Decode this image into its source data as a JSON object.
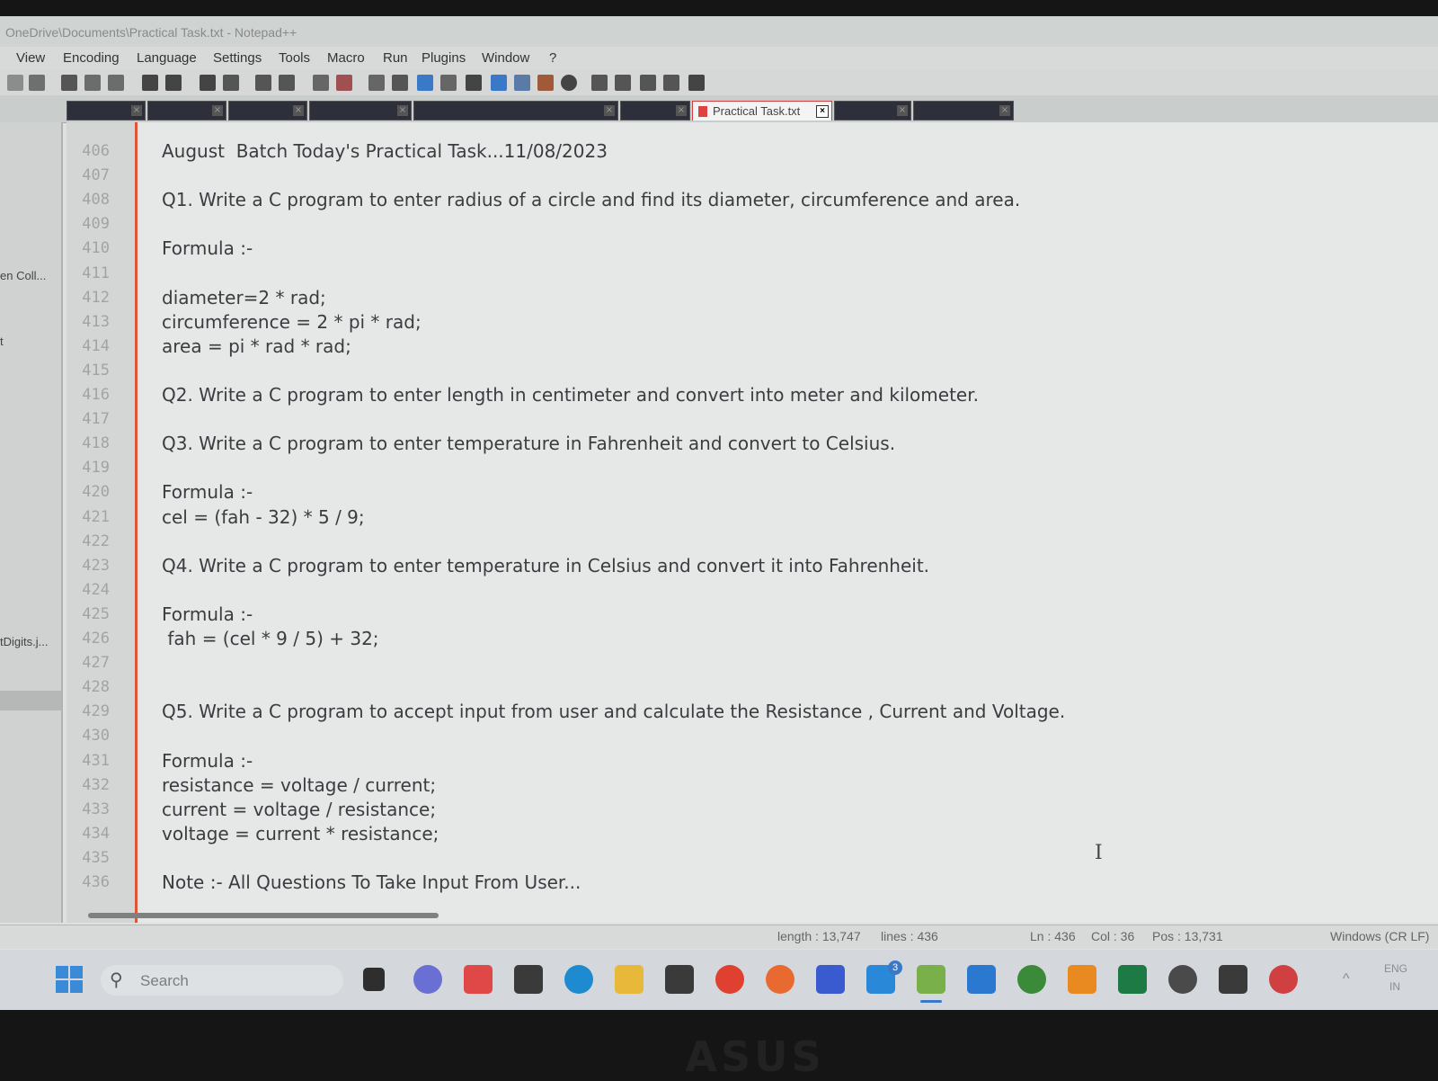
{
  "window": {
    "title": "OneDrive\\Documents\\Practical Task.txt - Notepad++"
  },
  "menu": [
    "View",
    "Encoding",
    "Language",
    "Settings",
    "Tools",
    "Macro",
    "Run",
    "Plugins",
    "Window",
    "?"
  ],
  "active_tab": {
    "label": "Practical Task.txt",
    "close": "×"
  },
  "left_panel": {
    "item1": "en Coll...",
    "item2": "t",
    "item3": "tDigits.j..."
  },
  "editor": {
    "line_numbers": [
      "406",
      "407",
      "408",
      "409",
      "410",
      "411",
      "412",
      "413",
      "414",
      "415",
      "416",
      "417",
      "418",
      "419",
      "420",
      "421",
      "422",
      "423",
      "424",
      "425",
      "426",
      "427",
      "428",
      "429",
      "430",
      "431",
      "432",
      "433",
      "434",
      "435",
      "436"
    ],
    "lines": [
      "August  Batch Today's Practical Task...11/08/2023",
      "",
      "Q1. Write a C program to enter radius of a circle and find its diameter, circumference and area.",
      "",
      "Formula :-",
      "",
      "diameter=2 * rad;",
      "circumference = 2 * pi * rad;",
      "area = pi * rad * rad;",
      "",
      "Q2. Write a C program to enter length in centimeter and convert into meter and kilometer.",
      "",
      "Q3. Write a C program to enter temperature in Fahrenheit and convert to Celsius.",
      "",
      "Formula :-",
      "cel = (fah - 32) * 5 / 9;",
      "",
      "Q4. Write a C program to enter temperature in Celsius and convert it into Fahrenheit.",
      "",
      "Formula :-",
      " fah = (cel * 9 / 5) + 32;",
      "",
      "",
      "Q5. Write a C program to accept input from user and calculate the Resistance , Current and Voltage.",
      "",
      "Formula :-",
      "resistance = voltage / current;",
      "current = voltage / resistance;",
      "voltage = current * resistance;",
      "",
      "Note :- All Questions To Take Input From User..."
    ]
  },
  "status": {
    "length": "length : 13,747",
    "lines": "lines : 436",
    "ln": "Ln : 436",
    "col": "Col : 36",
    "pos": "Pos : 13,731",
    "eol": "Windows (CR LF)"
  },
  "taskbar": {
    "search_placeholder": "Search",
    "mail_badge": "3",
    "tray_lang": "ENG",
    "tray_region": "IN"
  },
  "bezel_logo": "ASUS",
  "colors": {
    "editor_bg": "#e6e8e7",
    "gutter_border": "#e0553a",
    "text": "#3a3d40",
    "line_number": "#a0a4a4",
    "tab_accent": "#d04040"
  }
}
